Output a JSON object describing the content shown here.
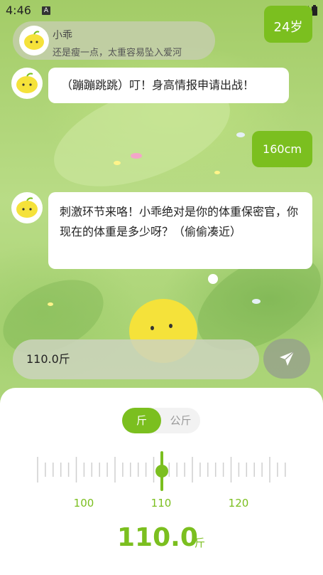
{
  "status_bar": {
    "time": "4:46",
    "indicator": "A"
  },
  "header": {
    "name": "小乖",
    "subtitle": "还是瘦一点，太重容易坠入爱河",
    "age_badge": "24岁"
  },
  "messages": [
    {
      "from": "bot",
      "text": "（蹦蹦跳跳）叮！身高情报申请出战！"
    },
    {
      "from": "user",
      "text": "160cm"
    },
    {
      "from": "bot",
      "text": "刺激环节来咯！小乖绝对是你的体重保密官，你现在的体重是多少呀？（偷偷凑近）"
    }
  ],
  "input": {
    "value": "110.0斤"
  },
  "picker": {
    "units": [
      "斤",
      "公斤"
    ],
    "selected_unit": "斤",
    "ruler_labels": [
      "100",
      "110",
      "120"
    ],
    "value": "110.0",
    "unit_suffix": "斤"
  },
  "colors": {
    "accent": "#7bbf1f",
    "bubble": "#ffffff",
    "mascot": "#f5e23a"
  },
  "icons": [
    "wifi-icon",
    "signal-icon",
    "battery-icon",
    "send-icon",
    "mascot-avatar"
  ]
}
